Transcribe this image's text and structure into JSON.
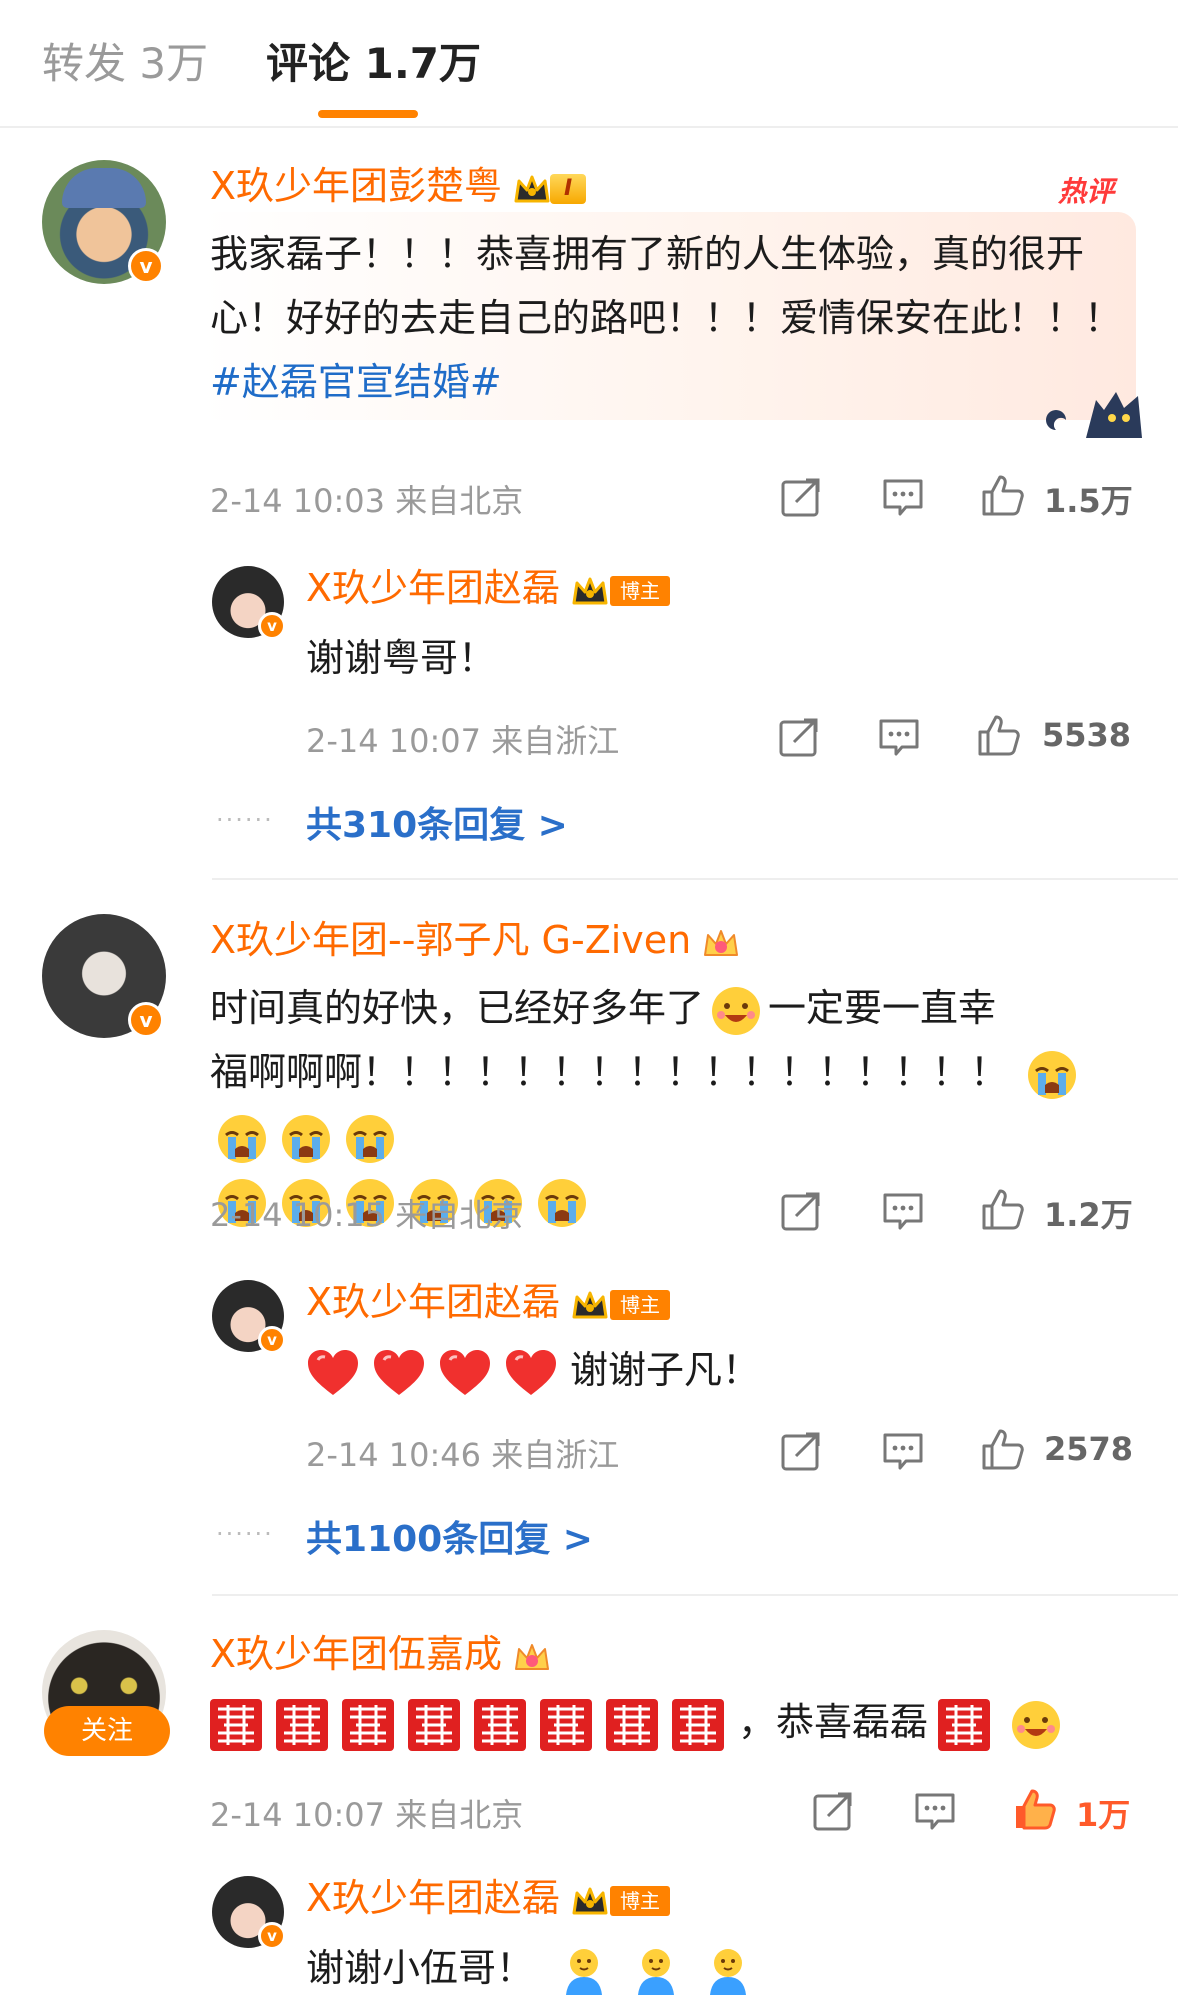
{
  "tabs": {
    "repost": "转发 3万",
    "comments": "评论 1.7万"
  },
  "colors": {
    "accent": "#ff8200",
    "name": "#ff6a00",
    "link": "#1f6cc8",
    "hot": "#ff3a3a"
  },
  "hot_label": "热评",
  "comments": [
    {
      "author": "X玖少年团彭楚粤",
      "level_badge": "I",
      "text": "我家磊子！！！恭喜拥有了新的人生体验，真的很开心！好好的去走自己的路吧！！！爱情保安在此！！！",
      "hashtag": "#赵磊官宣结婚#",
      "time": "2-14 10:03 来自北京",
      "likes": "1.5万",
      "reply": {
        "author": "X玖少年团赵磊",
        "badge": "博主",
        "text": "谢谢粤哥！",
        "time": "2-14 10:07 来自浙江",
        "likes": "5538"
      },
      "more_replies": "共310条回复 >"
    },
    {
      "author": "X玖少年团--郭子凡 G-Ziven",
      "text_a": "时间真的好快，已经好多年了",
      "text_b": "一定要一直幸",
      "text_c": "福啊啊啊！！！！！！！！！！！！！！！！！",
      "time": "2-14 10:15 来自北京",
      "likes": "1.2万",
      "reply": {
        "author": "X玖少年团赵磊",
        "badge": "博主",
        "text": "谢谢子凡！",
        "time": "2-14 10:46 来自浙江",
        "likes": "2578"
      },
      "more_replies": "共1100条回复 >"
    },
    {
      "author": "X玖少年团伍嘉成",
      "follow": "关注",
      "text": "，恭喜磊磊",
      "time": "2-14 10:07 来自北京",
      "likes": "1万",
      "reply": {
        "author": "X玖少年团赵磊",
        "badge": "博主",
        "text": "谢谢小伍哥！"
      }
    }
  ]
}
